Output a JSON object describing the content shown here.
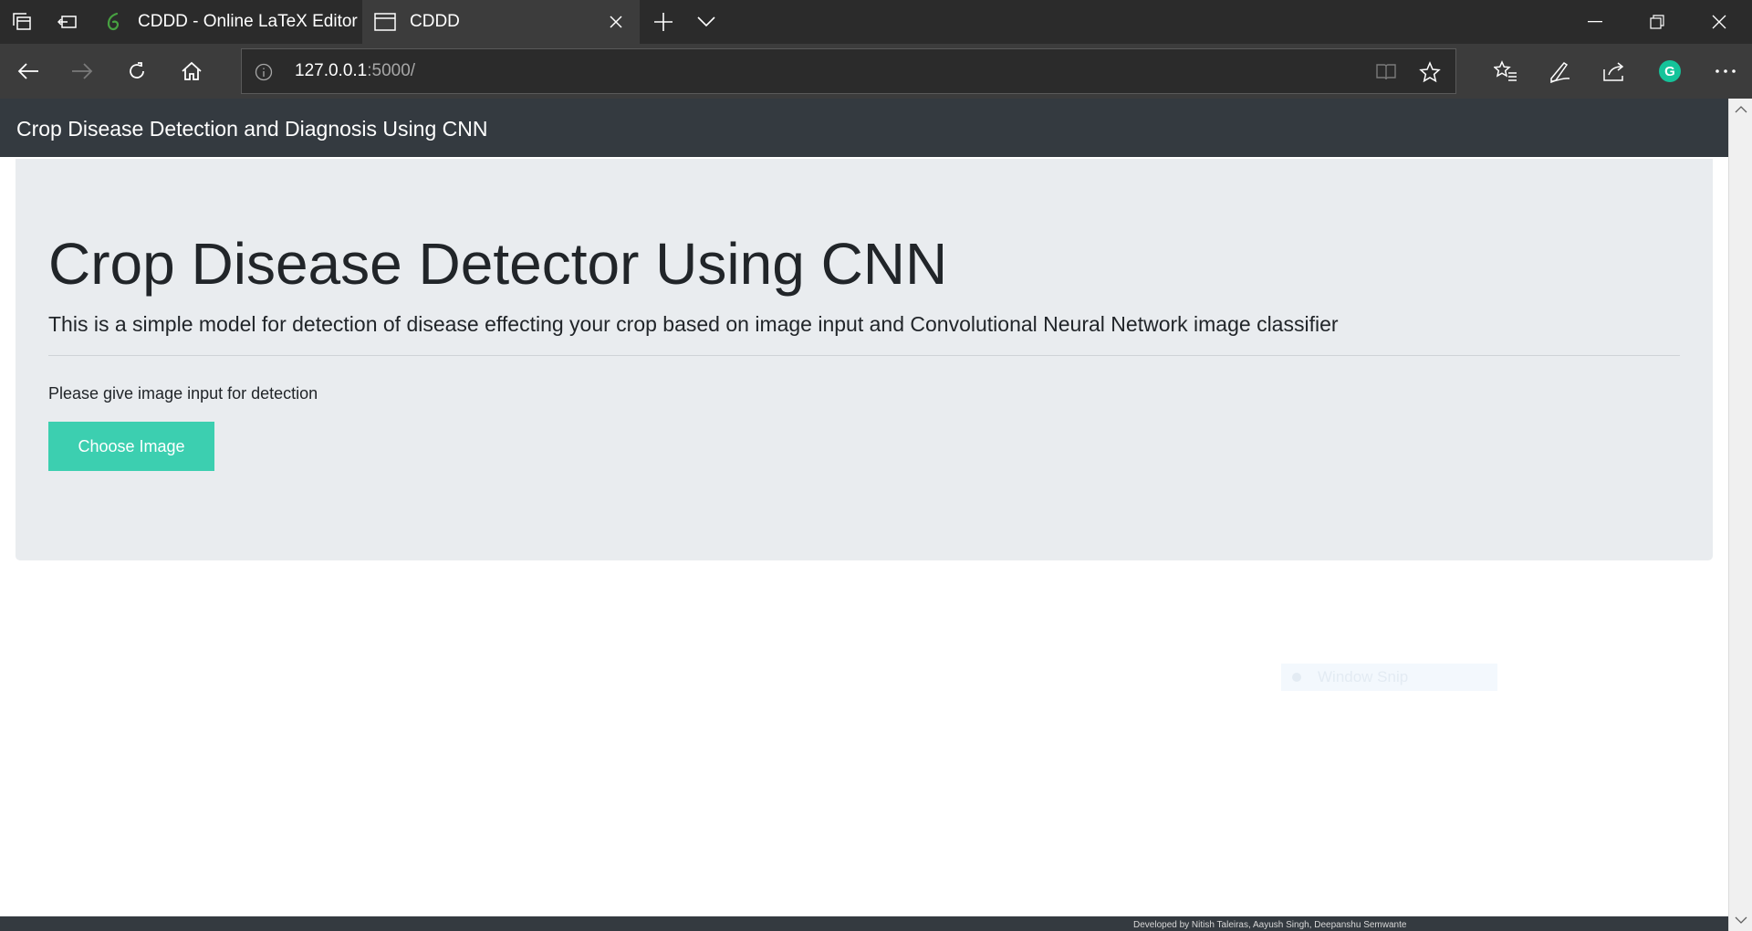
{
  "browser": {
    "tabs": [
      {
        "title": "CDDD - Online LaTeX Editor",
        "icon": "overleaf-leaf-icon",
        "active": false
      },
      {
        "title": "CDDD",
        "icon": "page-icon",
        "active": true
      }
    ],
    "url": {
      "host": "127.0.0.1",
      "path": ":5000/"
    },
    "accent_color": "#15c39a"
  },
  "site": {
    "brand": "Crop Disease Detection and Diagnosis Using CNN",
    "nav_color": "#343a40"
  },
  "jumbotron": {
    "title": "Crop Disease Detector Using CNN",
    "lead": "This is a simple model for detection of disease effecting your crop based on image input and Convolutional Neural Network image classifier",
    "prompt": "Please give image input for detection",
    "button_label": "Choose Image",
    "button_color": "#3ccfb0",
    "background": "#e9ecef"
  },
  "overlay": {
    "snip_label": "Window Snip"
  },
  "footer": {
    "text": "Developed by Nitish Taleiras, Aayush Singh, Deepanshu Semwante"
  }
}
